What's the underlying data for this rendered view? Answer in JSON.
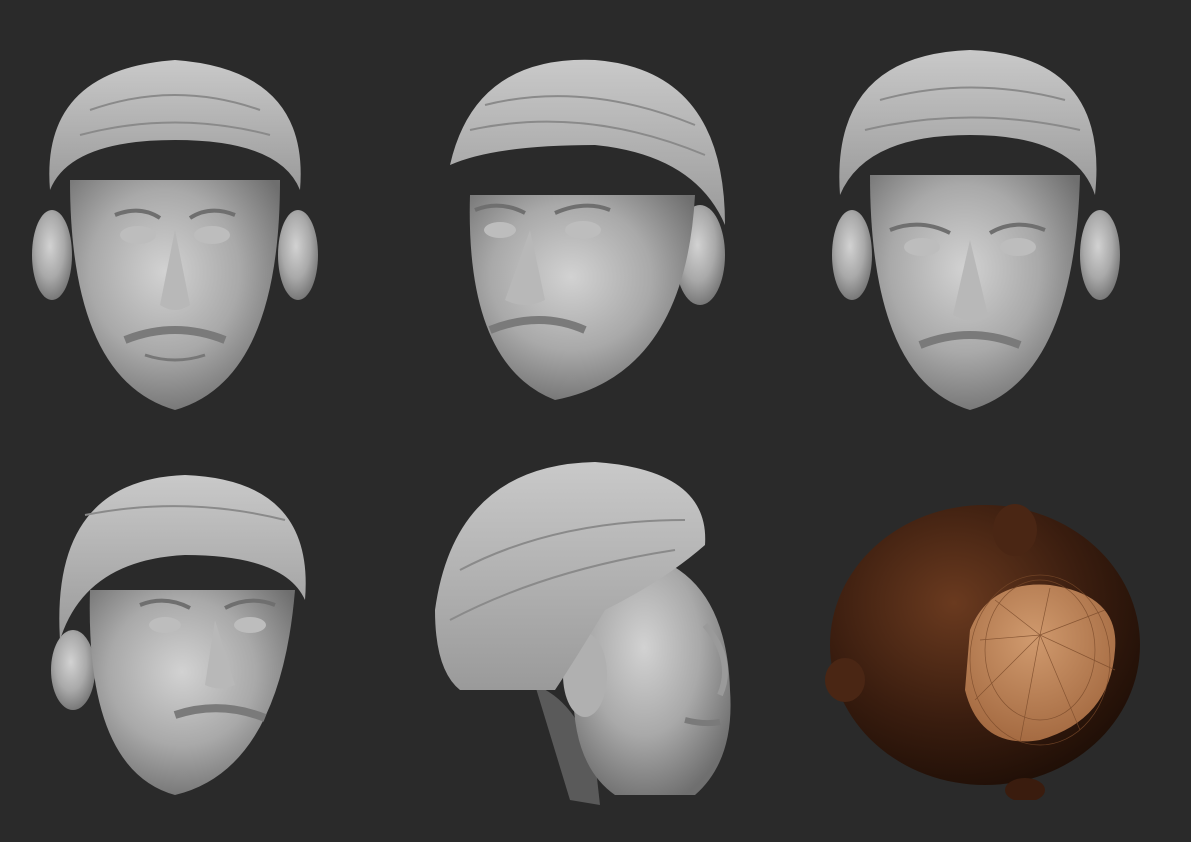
{
  "sheet": {
    "background_color": "#2a2a2a",
    "renders": [
      {
        "id": "front",
        "view": "front",
        "material": "clay"
      },
      {
        "id": "three-quarter-left",
        "view": "three-quarter",
        "material": "clay"
      },
      {
        "id": "front-alt",
        "view": "front",
        "material": "clay"
      },
      {
        "id": "three-quarter-low",
        "view": "three-quarter",
        "material": "clay"
      },
      {
        "id": "side-right",
        "view": "side",
        "material": "clay"
      },
      {
        "id": "underside-topology",
        "view": "bottom",
        "material": "wireframe"
      }
    ]
  },
  "colors": {
    "clay_light": "#c4c4c4",
    "clay_mid": "#a6a6a6",
    "clay_dark": "#6e6e6e",
    "hair": "#b9b9b9",
    "bronze_dark": "#2a140b",
    "bronze_mid": "#5a2f18",
    "cap": "#b5794e"
  }
}
